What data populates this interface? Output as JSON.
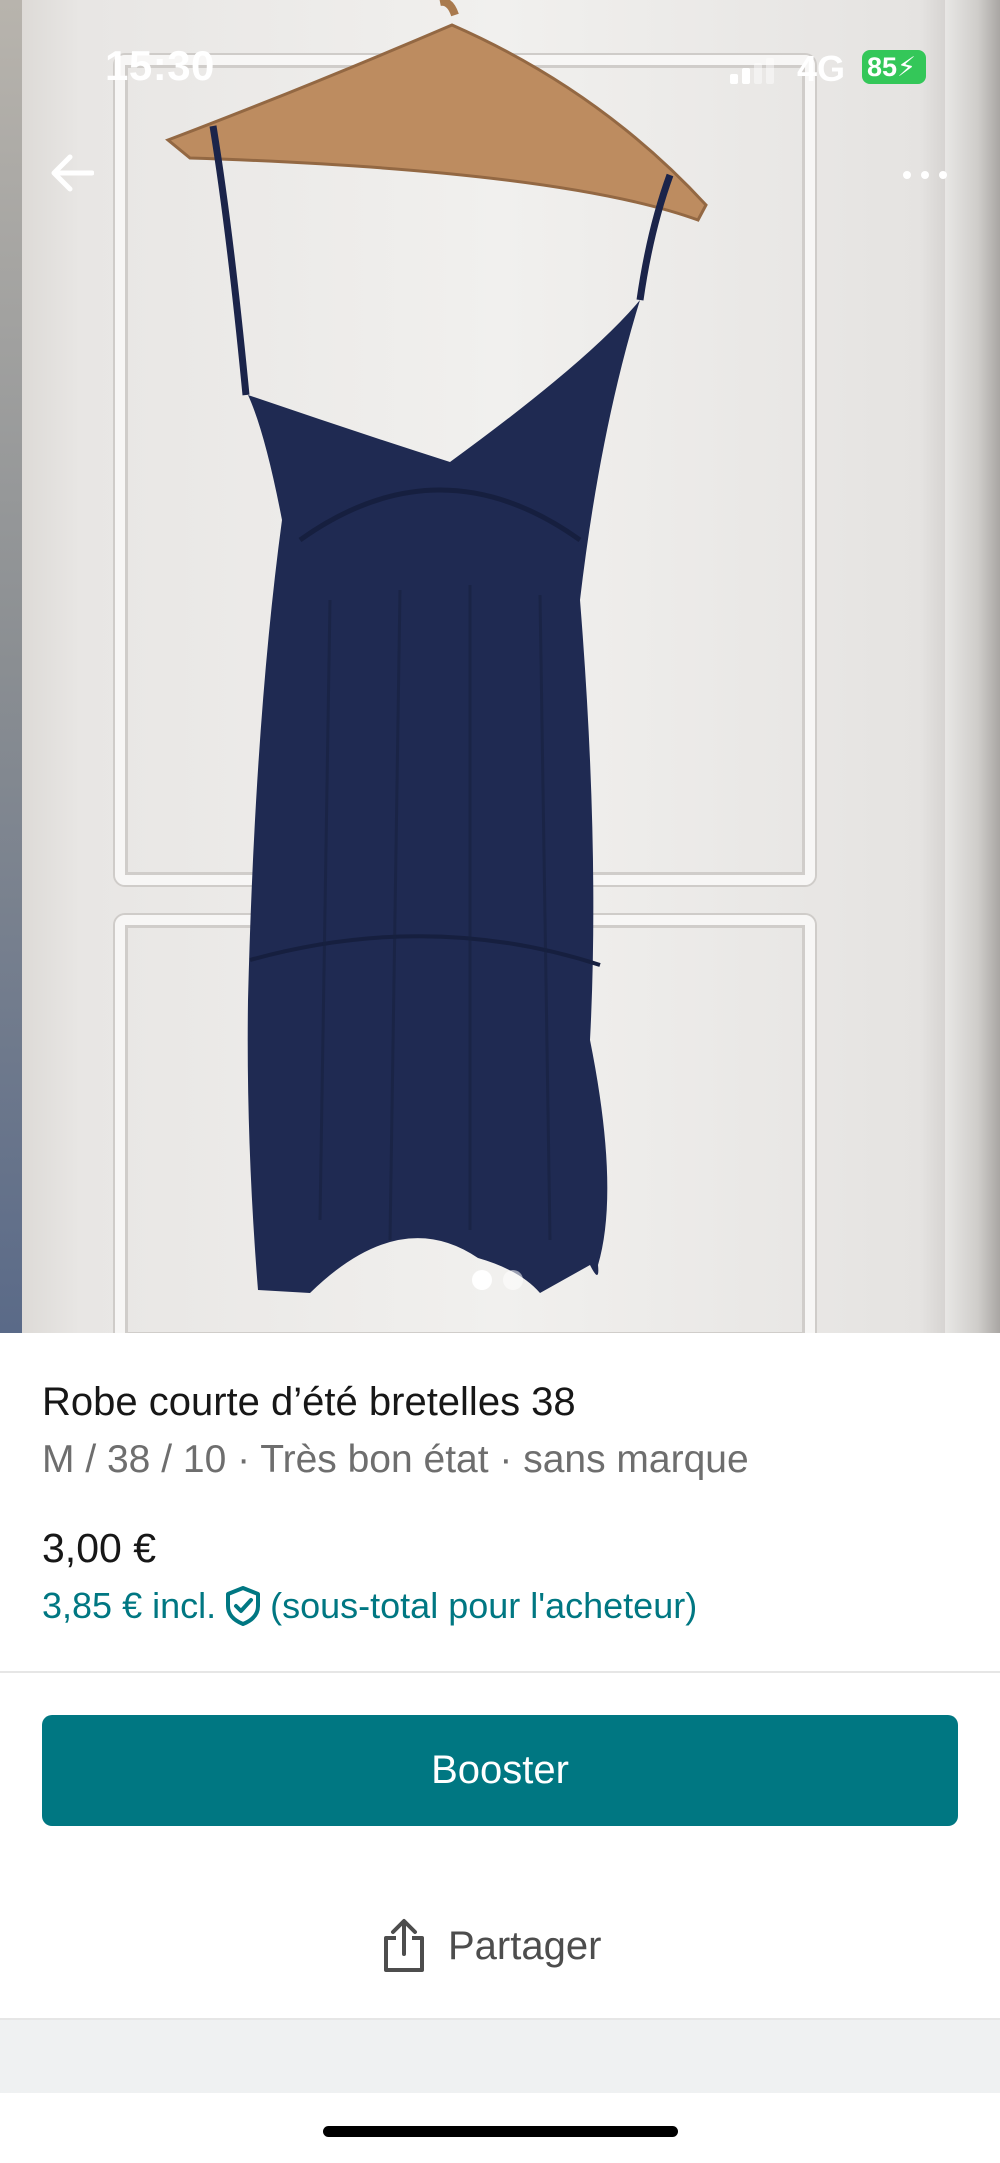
{
  "status_bar": {
    "time": "15:30",
    "network": "4G",
    "battery": "85"
  },
  "gallery": {
    "image_subject": "navy-strappy-dress-photo",
    "page_count": 2,
    "active_page": 1
  },
  "item": {
    "title": "Robe courte d’été bretelles 38",
    "meta": "M / 38 / 10 · Très bon état · sans marque",
    "price": "3,00 €",
    "buyer_price": "3,85 € incl.",
    "buyer_price_note": "(sous-total pour l'acheteur)"
  },
  "actions": {
    "booster_label": "Booster",
    "share_label": "Partager"
  },
  "colors": {
    "accent": "#007782",
    "battery": "#34c759",
    "dress": "#1f2a52"
  },
  "icons": {
    "back": "arrow-left-icon",
    "more": "more-horizontal-icon",
    "buyer_protection": "shield-check-icon",
    "share": "share-icon"
  }
}
